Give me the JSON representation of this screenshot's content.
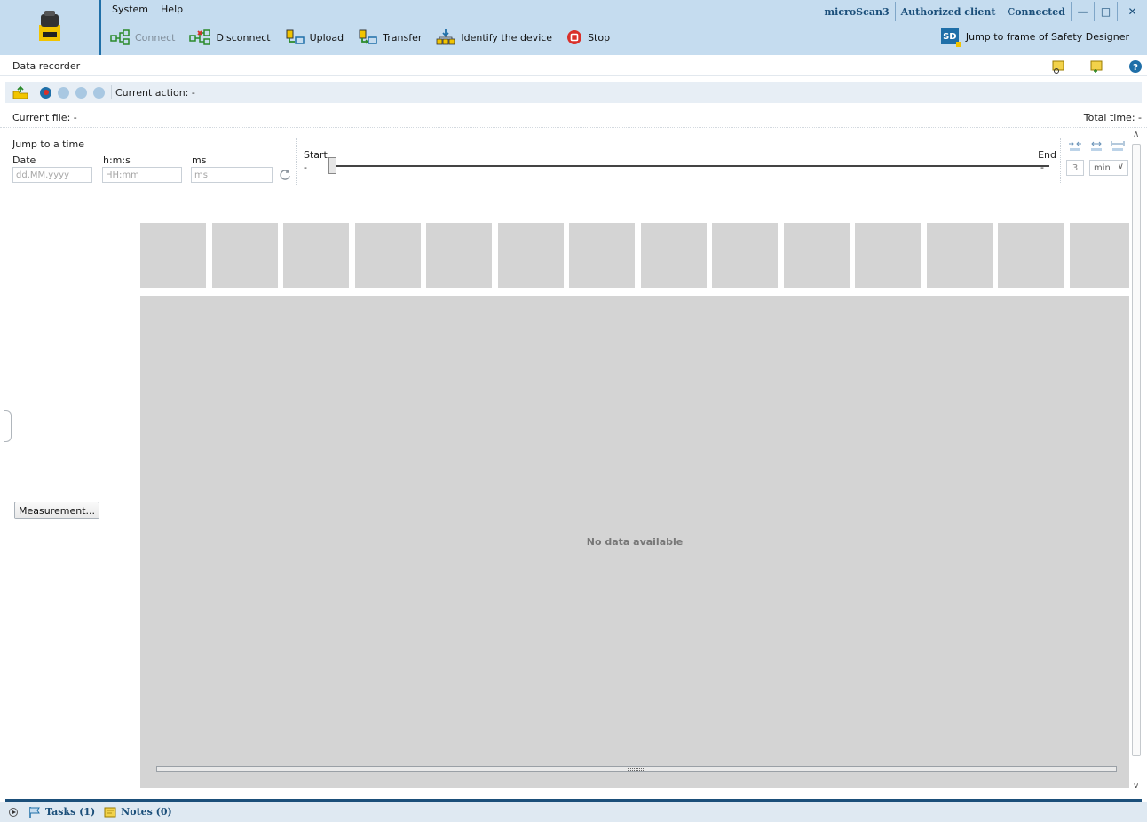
{
  "menu": {
    "system": "System",
    "help": "Help"
  },
  "status": {
    "device": "microScan3",
    "client": "Authorized client",
    "connection": "Connected",
    "min_btn": "—",
    "max_btn": "□",
    "close_btn": "✕"
  },
  "toolbar": {
    "connect": "Connect",
    "disconnect": "Disconnect",
    "upload": "Upload",
    "transfer": "Transfer",
    "identify": "Identify the device",
    "stop": "Stop",
    "jump_sd": "Jump to frame of Safety Designer",
    "sd_badge": "SD"
  },
  "page": {
    "title": "Data recorder",
    "current_action": "Current action: -",
    "current_file": "Current file: -",
    "total_time": "Total time: -"
  },
  "jump": {
    "heading": "Jump to a time",
    "date_label": "Date",
    "hms_label": "h:m:s",
    "ms_label": "ms",
    "date_placeholder": "dd.MM.yyyy",
    "hms_placeholder": "HH:mm",
    "ms_placeholder": "ms"
  },
  "slider": {
    "start_label": "Start",
    "start_value": "-",
    "end_label": "End",
    "end_value": "-"
  },
  "zoom": {
    "value": "3",
    "unit": "min"
  },
  "chart": {
    "no_data": "No data available"
  },
  "buttons": {
    "measurement": "Measurement..."
  },
  "bottom": {
    "tasks": "Tasks (1)",
    "notes": "Notes (0)"
  },
  "colors": {
    "accent": "#1f6fa8",
    "header_bg": "#c5dcef",
    "panel_gray": "#d4d4d4",
    "record_red": "#d9302a"
  }
}
